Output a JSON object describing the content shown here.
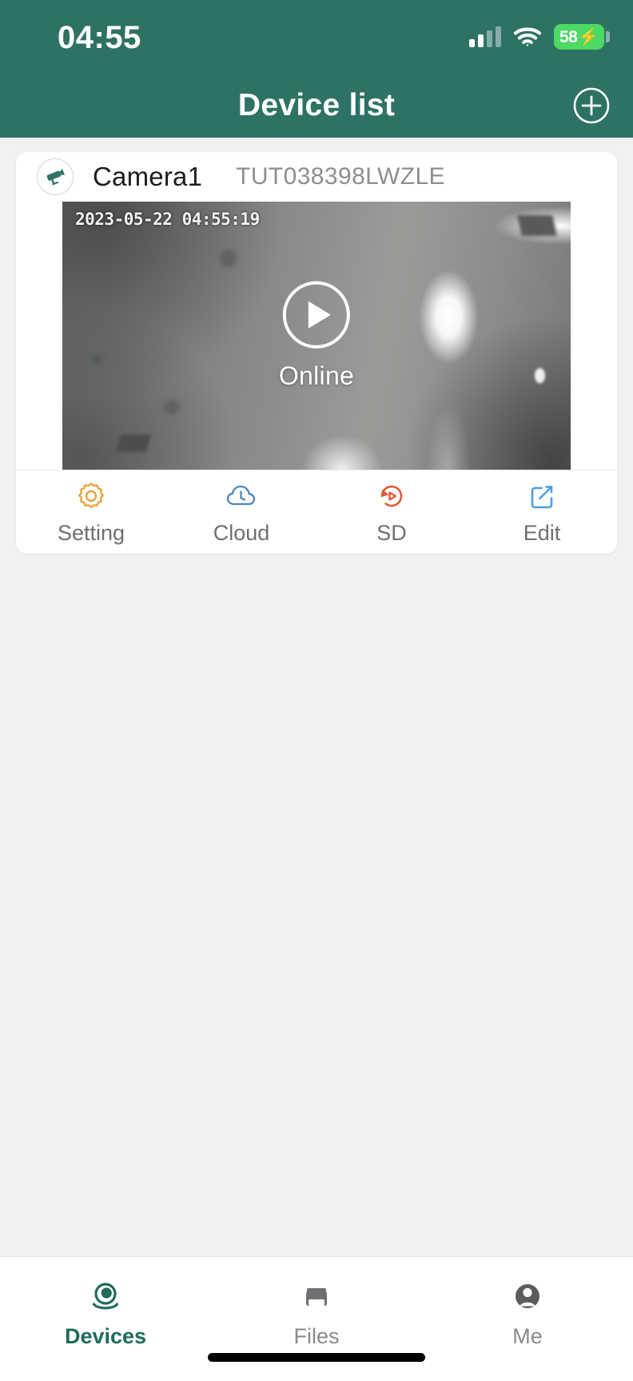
{
  "statusbar": {
    "time": "04:55",
    "battery_percent": "58",
    "battery_bolt": "⚡",
    "signal_icon": "cellular-signal-icon",
    "wifi_icon": "wifi-icon",
    "battery_color": "#4cd964"
  },
  "navbar": {
    "title": "Device list",
    "add_icon": "plus-circle-icon",
    "background_color": "#2e7264"
  },
  "device_card": {
    "status_icon": "cctv-camera-icon",
    "name": "Camera1",
    "uid": "TUT038398LWZLE",
    "video": {
      "timestamp": "2023-05-22 04:55:19",
      "status_label": "Online",
      "play_icon": "play-circle-icon"
    },
    "actions": [
      {
        "label": "Setting",
        "icon": "gear-icon",
        "color": "#e8a33d"
      },
      {
        "label": "Cloud",
        "icon": "cloud-clock-icon",
        "color": "#4a86c8"
      },
      {
        "label": "SD",
        "icon": "sd-playback-icon",
        "color": "#e05a36"
      },
      {
        "label": "Edit",
        "icon": "edit-pencil-icon",
        "color": "#4a9ee0"
      }
    ]
  },
  "tabbar": {
    "items": [
      {
        "label": "Devices",
        "icon": "camera-eye-icon",
        "active": true
      },
      {
        "label": "Files",
        "icon": "folder-icon",
        "active": false
      },
      {
        "label": "Me",
        "icon": "person-icon",
        "active": false
      }
    ],
    "active_color": "#1f6b5c",
    "inactive_color": "#8a8a8e"
  }
}
